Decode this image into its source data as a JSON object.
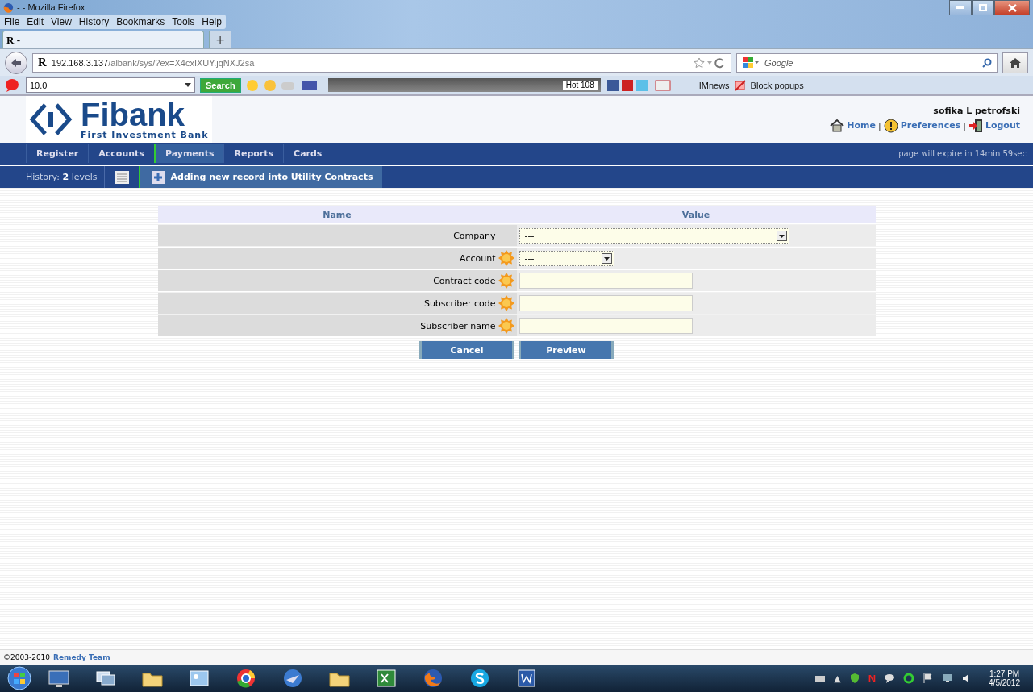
{
  "window": {
    "title": "- - Mozilla Firefox"
  },
  "menu": [
    "File",
    "Edit",
    "View",
    "History",
    "Bookmarks",
    "Tools",
    "Help"
  ],
  "tab": {
    "label": "R -",
    "new_tab": "+"
  },
  "address": {
    "site_letter": "R",
    "host": "192.168.3.137",
    "path": "/albank/sys/?ex=X4cxIXUY.jqNXJ2sa"
  },
  "search_box": {
    "placeholder": "Google"
  },
  "toolbar": {
    "zoom_value": "10.0",
    "search_button": "Search",
    "hot": "Hot 108",
    "links": [
      "IMnews",
      "Block popups"
    ]
  },
  "header": {
    "logo": "Fibank",
    "logo_subtitle": "First Investment Bank",
    "user": "sofika L petrofski",
    "links": [
      {
        "label": "Home",
        "kind": "home"
      },
      {
        "label": "Preferences",
        "kind": "preferences",
        "separator": "|"
      },
      {
        "label": "Logout",
        "kind": "logout",
        "separator": "|"
      }
    ]
  },
  "nav": [
    {
      "label": "Register",
      "selected": false
    },
    {
      "label": "Accounts",
      "selected": false
    },
    {
      "label": "Payments",
      "selected": true
    },
    {
      "label": "Reports",
      "selected": false
    },
    {
      "label": "Cards",
      "selected": false
    }
  ],
  "expiry": "page will expire in 14min 59sec",
  "history": {
    "label": "History: **2** levels",
    "breadcrumb": "Adding new record into Utility Contracts"
  },
  "form": {
    "columns": [
      "Name",
      "Value"
    ],
    "rows": [
      {
        "label": "Company",
        "required": false,
        "kind": "select",
        "value": "---"
      },
      {
        "label": "Account",
        "required": true,
        "kind": "select",
        "value": "---"
      },
      {
        "label": "Contract code",
        "required": true,
        "kind": "text"
      },
      {
        "label": "Subscriber code",
        "required": true,
        "kind": "text"
      },
      {
        "label": "Subscriber name",
        "required": true,
        "kind": "text"
      }
    ],
    "buttons": [
      "Cancel",
      "Preview"
    ]
  },
  "footer": {
    "copyright": "©2003-2010",
    "link": "Remedy Team"
  },
  "taskbar": {
    "apps": [
      {
        "kind": "desktop"
      },
      {
        "kind": "switcher"
      },
      {
        "kind": "folder"
      },
      {
        "kind": "control"
      },
      {
        "kind": "chrome"
      },
      {
        "kind": "thunderbird"
      },
      {
        "kind": "folder"
      },
      {
        "kind": "excel"
      },
      {
        "kind": "firefox"
      },
      {
        "kind": "skype"
      },
      {
        "kind": "word"
      }
    ],
    "tray": [
      {
        "kind": "keyboard"
      },
      {
        "kind": "arrow",
        "text": "▲"
      },
      {
        "kind": "shield"
      },
      {
        "kind": "letter",
        "text": "N"
      },
      {
        "kind": "bubble"
      },
      {
        "kind": "ring"
      },
      {
        "kind": "flag"
      },
      {
        "kind": "monitor"
      },
      {
        "kind": "speaker"
      }
    ],
    "time": "1:27 PM",
    "date": "4/5/2012"
  }
}
